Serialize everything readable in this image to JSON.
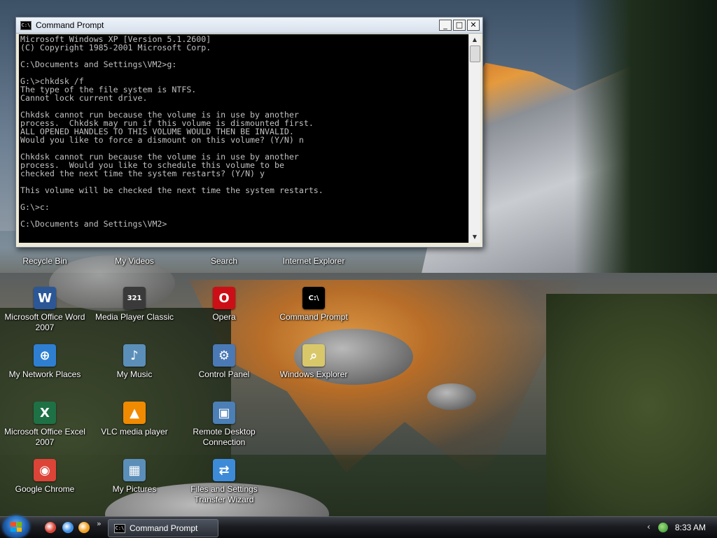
{
  "desktop": {
    "top_partial_labels": [
      "Recycle Bin",
      "My Videos",
      "Search",
      "Internet Explorer"
    ],
    "icons": [
      {
        "label": "Microsoft Office Word 2007",
        "icon": "word-icon",
        "color": "#2b5797",
        "glyph": "W"
      },
      {
        "label": "Media Player Classic",
        "icon": "media-player-classic-icon",
        "color": "#3a3a3a",
        "glyph": "321"
      },
      {
        "label": "Opera",
        "icon": "opera-icon",
        "color": "#cc0f16",
        "glyph": "O"
      },
      {
        "label": "Command Prompt",
        "icon": "command-prompt-icon",
        "color": "#000000",
        "glyph": "C:\\"
      },
      {
        "label": "My Network Places",
        "icon": "network-places-icon",
        "color": "#2e7fd1",
        "glyph": "⊕"
      },
      {
        "label": "My Music",
        "icon": "music-folder-icon",
        "color": "#5b8fb9",
        "glyph": "♪"
      },
      {
        "label": "Control Panel",
        "icon": "control-panel-icon",
        "color": "#4a79b5",
        "glyph": "⚙"
      },
      {
        "label": "Windows Explorer",
        "icon": "windows-explorer-icon",
        "color": "#d8c86a",
        "glyph": "⌕"
      },
      {
        "label": "Microsoft Office Excel 2007",
        "icon": "excel-icon",
        "color": "#1e7145",
        "glyph": "X"
      },
      {
        "label": "VLC media player",
        "icon": "vlc-icon",
        "color": "#f08a00",
        "glyph": "▲"
      },
      {
        "label": "Remote Desktop Connection",
        "icon": "remote-desktop-icon",
        "color": "#4b7fb6",
        "glyph": "▣"
      },
      {
        "label": "Google Chrome",
        "icon": "chrome-icon",
        "color": "#db4437",
        "glyph": "◉"
      },
      {
        "label": "My Pictures",
        "icon": "pictures-folder-icon",
        "color": "#5b8fb9",
        "glyph": "▦"
      },
      {
        "label": "Files and Settings Transfer Wizard",
        "icon": "transfer-wizard-icon",
        "color": "#3d8bd8",
        "glyph": "⇄"
      }
    ]
  },
  "cmd_window": {
    "title": "Command Prompt",
    "icon_text": "C:\\",
    "minimize": "_",
    "maximize": "□",
    "close": "✕",
    "lines": [
      "Microsoft Windows XP [Version 5.1.2600]",
      "(C) Copyright 1985-2001 Microsoft Corp.",
      "",
      "C:\\Documents and Settings\\VM2>g:",
      "",
      "G:\\>chkdsk /f",
      "The type of the file system is NTFS.",
      "Cannot lock current drive.",
      "",
      "Chkdsk cannot run because the volume is in use by another",
      "process.  Chkdsk may run if this volume is dismounted first.",
      "ALL OPENED HANDLES TO THIS VOLUME WOULD THEN BE INVALID.",
      "Would you like to force a dismount on this volume? (Y/N) n",
      "",
      "Chkdsk cannot run because the volume is in use by another",
      "process.  Would you like to schedule this volume to be",
      "checked the next time the system restarts? (Y/N) y",
      "",
      "This volume will be checked the next time the system restarts.",
      "",
      "G:\\>c:",
      "",
      "C:\\Documents and Settings\\VM2>"
    ]
  },
  "taskbar": {
    "more": "»",
    "task_label": "Command Prompt",
    "task_icon_text": "C:\\",
    "tray_chevron": "‹",
    "clock": "8:33 AM",
    "quicklaunch": [
      {
        "icon": "chrome-quicklaunch-icon",
        "color": "#db4437"
      },
      {
        "icon": "ie-quicklaunch-icon",
        "color": "#3a8ee6"
      },
      {
        "icon": "media-quicklaunch-icon",
        "color": "#f0a020"
      }
    ]
  }
}
